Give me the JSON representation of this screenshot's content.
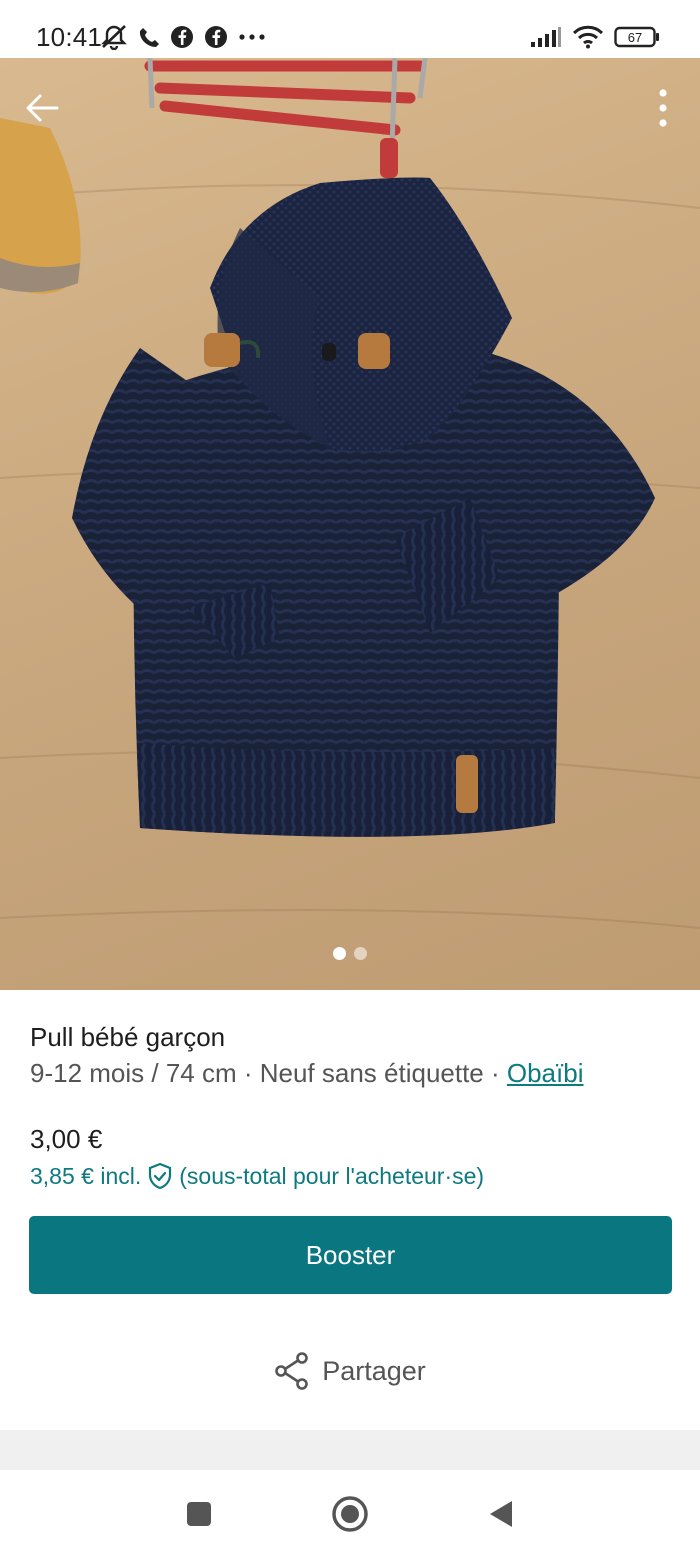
{
  "status_bar": {
    "time": "10:41",
    "battery_level": "67",
    "icons_left": [
      "mute-icon",
      "phone-call-icon",
      "facebook-icon",
      "facebook-icon",
      "more-dots-icon"
    ],
    "icons_right": [
      "signal-icon",
      "wifi-icon",
      "battery-icon"
    ]
  },
  "gallery": {
    "image_count": 2,
    "active_index": 0,
    "icon_back": "arrow-left-icon",
    "icon_more": "more-vertical-icon"
  },
  "item": {
    "title": "Pull bébé garçon",
    "details": "9-12 mois / 74 cm · Neuf sans étiquette · ",
    "brand": "Obaïbi",
    "price": "3,00 €",
    "price_incl_prefix": "3,85 € incl.",
    "price_incl_suffix": "(sous-total pour l'acheteur·se)"
  },
  "actions": {
    "booster_label": "Booster",
    "share_label": "Partager"
  },
  "colors": {
    "accent": "#0a7680",
    "accent_text": "#0d7a80",
    "text_primary": "#1e1e1e",
    "text_secondary": "#555555"
  }
}
